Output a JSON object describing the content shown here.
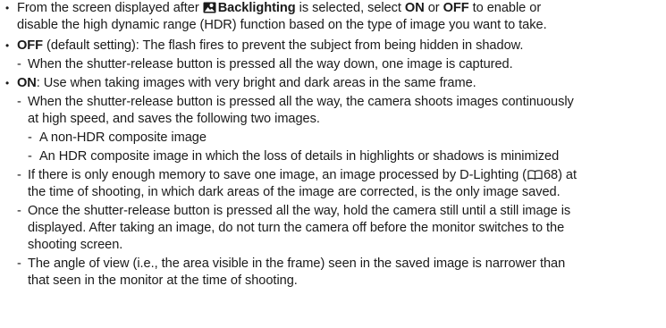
{
  "paragraphs": {
    "p1": {
      "bullet": "•",
      "pre": "From the screen displayed after ",
      "icon_name": "backlighting-scene-icon",
      "label": "Backlighting",
      "mid1": " is selected, select ",
      "on": "ON",
      "or": " or ",
      "off": "OFF",
      "post": " to enable or",
      "line2": "disable the high dynamic range (HDR) function based on the type of image you want to take."
    },
    "p2": {
      "bullet": "•",
      "off": "OFF",
      "post": " (default setting): The flash fires to prevent the subject from being hidden in shadow."
    },
    "p2a": {
      "dash": "-",
      "text": "When the shutter-release button is pressed all the way down, one image is captured."
    },
    "p3": {
      "bullet": "•",
      "on": "ON",
      "post": ": Use when taking images with very bright and dark areas in the same frame."
    },
    "p3a": {
      "dash": "-",
      "line1": "When the shutter-release button is pressed all the way, the camera shoots images continuously",
      "line2": "at high speed, and saves the following two images."
    },
    "p3a1": {
      "dash": "-",
      "text": "A non-HDR composite image"
    },
    "p3a2": {
      "dash": "-",
      "text": "An HDR composite image in which the loss of details in highlights or shadows is minimized"
    },
    "p3b": {
      "dash": "-",
      "pre": "If there is only enough memory to save one image, an image processed by D-Lighting (",
      "icon_name": "reference-book-icon",
      "page_ref": "68",
      "post": ") at",
      "line2": "the time of shooting, in which dark areas of the image are corrected, is the only image saved."
    },
    "p3c": {
      "dash": "-",
      "line1": "Once the shutter-release button is pressed all the way, hold the camera still until a still image is",
      "line2": "displayed. After taking an image, do not turn the camera off before the monitor switches to the",
      "line3": "shooting screen."
    },
    "p3d": {
      "dash": "-",
      "line1": "The angle of view (i.e., the area visible in the frame) seen in the saved image is narrower than",
      "line2": "that seen in the monitor at the time of shooting."
    }
  }
}
